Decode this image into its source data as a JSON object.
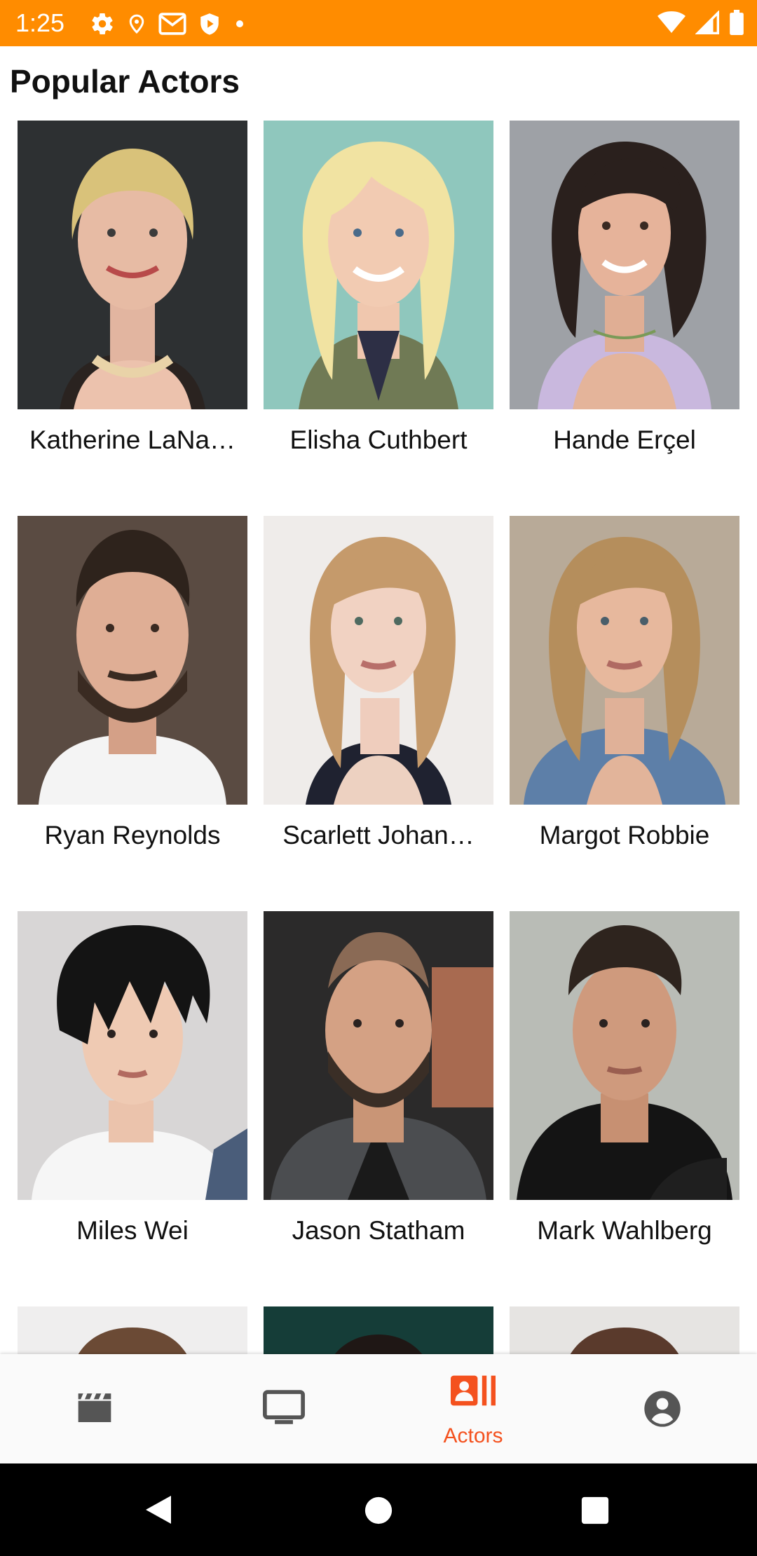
{
  "status_bar": {
    "time": "1:25",
    "left_icons": [
      "settings-icon",
      "location-icon",
      "gmail-icon",
      "play-protect-icon",
      "dot-icon"
    ],
    "right_icons": [
      "wifi-icon",
      "signal-icon",
      "battery-icon"
    ],
    "background": "#FF8C00"
  },
  "header": {
    "title": "Popular Actors"
  },
  "actors": [
    {
      "name": "Katherine LaNa…",
      "photo": "portrait"
    },
    {
      "name": "Elisha Cuthbert",
      "photo": "portrait"
    },
    {
      "name": "Hande Erçel",
      "photo": "portrait"
    },
    {
      "name": "Ryan Reynolds",
      "photo": "portrait"
    },
    {
      "name": "Scarlett Johan…",
      "photo": "portrait"
    },
    {
      "name": "Margot Robbie",
      "photo": "portrait"
    },
    {
      "name": "Miles Wei",
      "photo": "portrait"
    },
    {
      "name": "Jason Statham",
      "photo": "portrait"
    },
    {
      "name": "Mark Wahlberg",
      "photo": "portrait"
    },
    {
      "name": "",
      "photo": "portrait"
    },
    {
      "name": "",
      "photo": "portrait"
    },
    {
      "name": "",
      "photo": "portrait"
    }
  ],
  "bottom_nav": {
    "items": [
      {
        "icon": "movie-clapper-icon",
        "label": ""
      },
      {
        "icon": "tv-icon",
        "label": ""
      },
      {
        "icon": "actors-icon",
        "label": "Actors",
        "selected": true
      },
      {
        "icon": "account-icon",
        "label": ""
      }
    ],
    "active_color": "#F4511E",
    "inactive_color": "#555555"
  },
  "system_nav": {
    "buttons": [
      "back-icon",
      "home-icon",
      "recents-icon"
    ]
  }
}
